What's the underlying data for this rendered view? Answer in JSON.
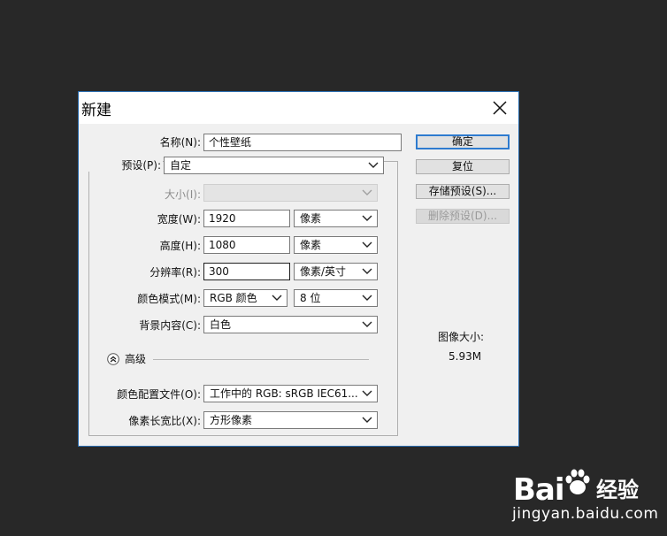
{
  "dialog": {
    "title": "新建",
    "close_icon": "close-icon"
  },
  "form": {
    "name": {
      "label": "名称(N):",
      "value": "个性壁纸"
    },
    "preset": {
      "label": "预设(P):",
      "value": "自定"
    },
    "size": {
      "label": "大小(I):",
      "value": ""
    },
    "width": {
      "label": "宽度(W):",
      "value": "1920",
      "unit": "像素"
    },
    "height": {
      "label": "高度(H):",
      "value": "1080",
      "unit": "像素"
    },
    "resolution": {
      "label": "分辨率(R):",
      "value": "300",
      "unit": "像素/英寸"
    },
    "color_mode": {
      "label": "颜色模式(M):",
      "mode": "RGB 颜色",
      "bits": "8 位"
    },
    "background": {
      "label": "背景内容(C):",
      "value": "白色"
    },
    "advanced": {
      "label": "高级",
      "icon": "collapse-up-icon"
    },
    "color_profile": {
      "label": "颜色配置文件(O):",
      "value": "工作中的 RGB: sRGB IEC61..."
    },
    "pixel_aspect": {
      "label": "像素长宽比(X):",
      "value": "方形像素"
    }
  },
  "buttons": {
    "ok": "确定",
    "reset": "复位",
    "save_preset": "存储预设(S)...",
    "delete_preset": "删除预设(D)..."
  },
  "image_size": {
    "label": "图像大小:",
    "value": "5.93M"
  },
  "watermark": {
    "brand": "Bai",
    "brand_cn": "经验",
    "url": "jingyan.baidu.com"
  },
  "colors": {
    "background": "#282828",
    "dialog": "#f0f0f0",
    "accent": "#2e7bcf"
  }
}
